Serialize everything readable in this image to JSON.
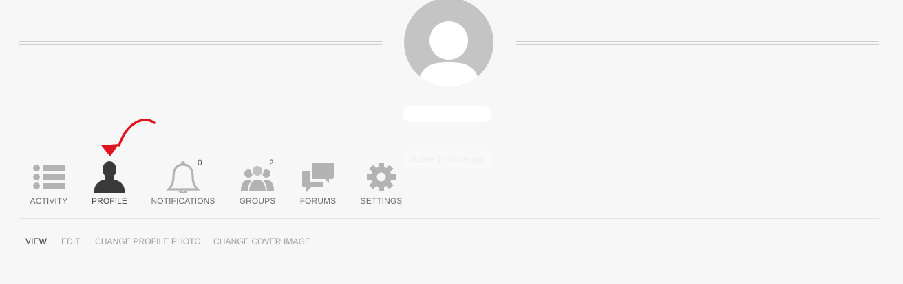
{
  "profile": {
    "last_active": "Active 1 minute ago"
  },
  "nav": {
    "items": [
      {
        "label": "ACTIVITY",
        "icon": "list-icon"
      },
      {
        "label": "PROFILE",
        "icon": "person-icon",
        "active": true
      },
      {
        "label": "NOTIFICATIONS",
        "icon": "bell-icon",
        "count": "0"
      },
      {
        "label": "GROUPS",
        "icon": "group-icon",
        "count": "2"
      },
      {
        "label": "FORUMS",
        "icon": "chat-bubbles-icon"
      },
      {
        "label": "SETTINGS",
        "icon": "gear-icon"
      }
    ]
  },
  "subnav": {
    "items": [
      {
        "label": "VIEW",
        "current": true
      },
      {
        "label": "EDIT"
      },
      {
        "label": "CHANGE PROFILE PHOTO"
      },
      {
        "label": "CHANGE COVER IMAGE"
      }
    ]
  },
  "colors": {
    "background": "#f7f7f7",
    "icon_gray": "#b3b3b3",
    "icon_active": "#3a3a3a",
    "annotation_red": "#e0141e"
  }
}
